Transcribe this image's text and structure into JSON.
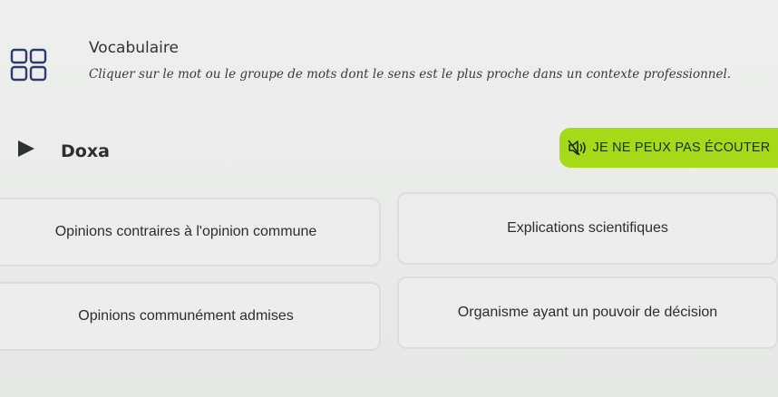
{
  "header": {
    "icon": "grid-icon",
    "title": "Vocabulaire",
    "instruction": "Cliquer sur le mot ou le groupe de mots dont le sens est le plus proche dans un contexte professionnel."
  },
  "prompt": {
    "play_icon": "play-icon",
    "word": "Doxa"
  },
  "cant_listen": {
    "icon": "speaker-muted-icon",
    "label": "JE NE PEUX PAS ÉCOUTER",
    "color": "#a6d917"
  },
  "options": [
    {
      "label": "Opinions contraires à l'opinion commune"
    },
    {
      "label": "Explications scientifiques"
    },
    {
      "label": "Opinions communément admises"
    },
    {
      "label": "Organisme ayant un pouvoir de décision"
    }
  ]
}
